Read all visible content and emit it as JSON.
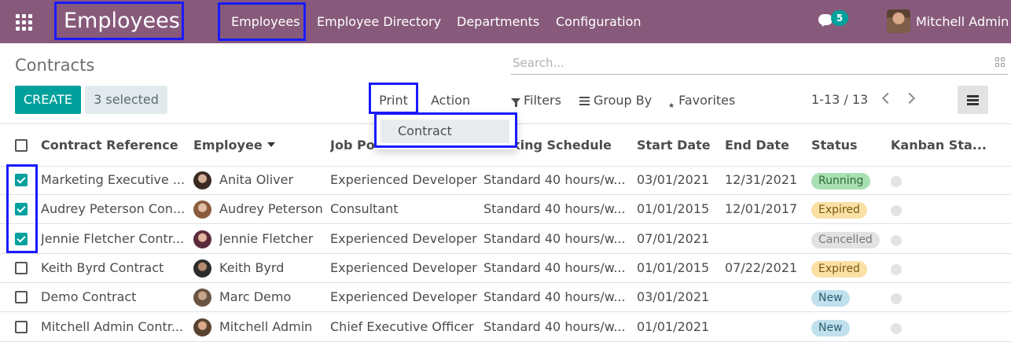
{
  "nav": {
    "brand": "Employees",
    "menus": [
      "Employees",
      "Employee Directory",
      "Departments",
      "Configuration"
    ],
    "chat_count": "5",
    "user_name": "Mitchell Admin"
  },
  "control": {
    "breadcrumb": "Contracts",
    "search_placeholder": "Search...",
    "create_label": "CREATE",
    "selected_label": "3 selected",
    "print_label": "Print",
    "action_label": "Action",
    "print_menu_item": "Contract",
    "filters_label": "Filters",
    "groupby_label": "Group By",
    "favorites_label": "Favorites",
    "pager": "1-13 / 13"
  },
  "table": {
    "columns": [
      "Contract Reference",
      "Employee",
      "Job Position",
      "Working Schedule",
      "Start Date",
      "End Date",
      "Status",
      "Kanban Sta..."
    ],
    "rows": [
      {
        "ref": "Marketing Executive ...",
        "employee": "Anita Oliver",
        "job": "Experienced Developer",
        "schedule": "Standard 40 hours/w...",
        "start": "03/01/2021",
        "end": "12/31/2021",
        "status": "Running",
        "checked": true
      },
      {
        "ref": "Audrey Peterson Con...",
        "employee": "Audrey Peterson",
        "job": "Consultant",
        "schedule": "Standard 40 hours/w...",
        "start": "01/01/2015",
        "end": "12/01/2017",
        "status": "Expired",
        "checked": true
      },
      {
        "ref": "Jennie Fletcher Contr...",
        "employee": "Jennie Fletcher",
        "job": "Experienced Developer",
        "schedule": "Standard 40 hours/w...",
        "start": "07/01/2021",
        "end": "",
        "status": "Cancelled",
        "checked": true
      },
      {
        "ref": "Keith Byrd Contract",
        "employee": "Keith Byrd",
        "job": "Experienced Developer",
        "schedule": "Standard 40 hours/w...",
        "start": "01/01/2015",
        "end": "07/22/2021",
        "status": "Expired",
        "checked": false
      },
      {
        "ref": "Demo Contract",
        "employee": "Marc Demo",
        "job": "Experienced Developer",
        "schedule": "Standard 40 hours/w...",
        "start": "03/01/2021",
        "end": "",
        "status": "New",
        "checked": false
      },
      {
        "ref": "Mitchell Admin Contr...",
        "employee": "Mitchell Admin",
        "job": "Chief Executive Officer",
        "schedule": "Standard 40 hours/w...",
        "start": "01/01/2021",
        "end": "",
        "status": "New",
        "checked": false
      }
    ]
  },
  "colors": {
    "navbar": "#875a7b",
    "primary": "#00a09d",
    "highlight": "#1a1aff",
    "status_running": "#a8e0b3",
    "status_expired": "#fbe0a6",
    "status_cancelled": "#e2e2e2",
    "status_new": "#bfe0ec"
  }
}
